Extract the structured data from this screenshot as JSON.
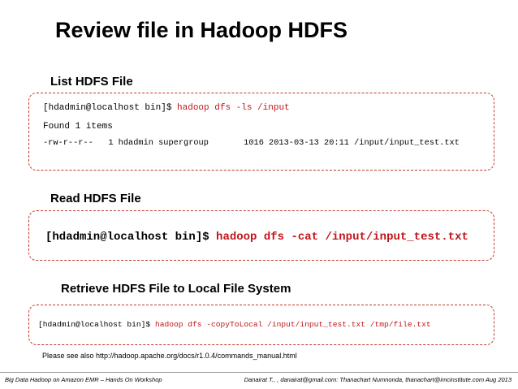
{
  "slide": {
    "title": "Review file in Hadoop HDFS"
  },
  "sections": [
    {
      "heading": "List HDFS File",
      "prompt": "[hdadmin@localhost bin]$ ",
      "command": "hadoop dfs -ls /input",
      "output": [
        "Found 1 items",
        "-rw-r--r--   1 hdadmin supergroup       1016 2013-03-13 20:11 /input/input_test.txt"
      ]
    },
    {
      "heading": "Read HDFS File",
      "prompt": "[hdadmin@localhost bin]$ ",
      "command": "hadoop dfs -cat /input/input_test.txt"
    },
    {
      "heading": "Retrieve HDFS File to Local File System",
      "prompt": "[hdadmin@localhost bin]$ ",
      "command": "hadoop dfs -copyToLocal /input/input_test.txt /tmp/file.txt"
    }
  ],
  "note": "Please see also http://hadoop.apache.org/docs/r1.0.4/commands_manual.html",
  "footer": {
    "left": "Big Data Hadoop on Amazon EMR – Hands On Workshop",
    "right": "Danairat T., , danairat@gmail.com:  Thanachart Numnonda,  thanachart@imcinstitute.com   Aug 2013"
  },
  "colors": {
    "command": "#c0151b",
    "box_border": "#c0392b"
  }
}
